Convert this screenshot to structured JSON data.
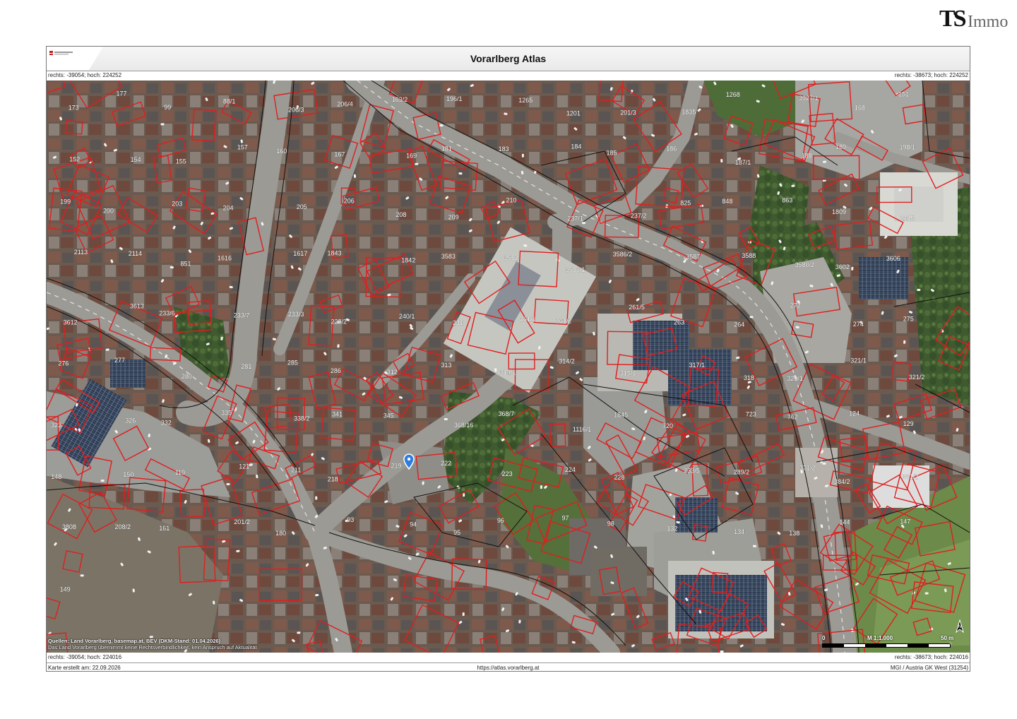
{
  "brand": {
    "ts": "TS",
    "immo": "Immo"
  },
  "header": {
    "title": "Vorarlberg Atlas"
  },
  "coords": {
    "top_left": "rechts: -39054; hoch: 224252",
    "top_right": "rechts: -38673; hoch: 224252",
    "bottom_left": "rechts: -39054; hoch: 224016",
    "bottom_right": "rechts: -38673; hoch: 224016"
  },
  "footer": {
    "created": "Karte erstellt am: 22.09.2026",
    "url": "https://atlas.vorarlberg.at",
    "crs": "MGI / Austria GK West (31254)"
  },
  "map": {
    "sources_line1": "Quellen: Land Vorarlberg, basemap.at, BEV (DKM-Stand: 01.04.2026)",
    "sources_line2": "Das Land Vorarlberg übernimmt keine Rechtsverbindlichkeit, kein Anspruch auf Aktualität",
    "scale_zero": "0",
    "scale_ratio": "M 1:1.000",
    "scale_max": "50 m",
    "north_label": "N",
    "parcels": [
      "173",
      "177",
      "99",
      "88/1",
      "206/3",
      "206/4",
      "163/2",
      "196/1",
      "1265",
      "1201",
      "201/3",
      "1835",
      "1268",
      "3927/1",
      "168",
      "151",
      "152",
      "154",
      "155",
      "157",
      "160",
      "167",
      "169",
      "181",
      "183",
      "184",
      "185",
      "186",
      "187/1",
      "188",
      "189",
      "198/1",
      "199",
      "200",
      "203",
      "204",
      "205",
      "206",
      "208",
      "209",
      "210",
      "237/1",
      "237/2",
      "825",
      "848",
      "863",
      "1809",
      "2115",
      "2113",
      "2114",
      "851",
      "1616",
      "1617",
      "1843",
      "1842",
      "3583",
      "3582",
      "3586/1",
      "3586/2",
      "3587",
      "3588",
      "3580/2",
      "3602",
      "3606",
      "3612",
      "3613",
      "233/6",
      "233/7",
      "233/3",
      "228/2",
      "240/1",
      "241",
      "261/1",
      "261/2",
      "261/5",
      "263",
      "264",
      "272",
      "274",
      "275",
      "276",
      "277",
      "280",
      "281",
      "285",
      "286",
      "312",
      "313",
      "314/1",
      "314/2",
      "315/1",
      "317/1",
      "318",
      "320/1",
      "321/1",
      "321/2",
      "323",
      "326",
      "332",
      "335",
      "338/2",
      "341",
      "345",
      "368/16",
      "368/7",
      "1116/1",
      "1845",
      "720",
      "723",
      "762",
      "124",
      "129",
      "148",
      "150",
      "119",
      "121",
      "211",
      "218",
      "219",
      "222",
      "223",
      "224",
      "228",
      "233/5",
      "289/2",
      "371/2",
      "384/2",
      "381/2",
      "3808",
      "208/2",
      "161",
      "201/2",
      "180",
      "93",
      "94",
      "95",
      "96",
      "97",
      "98",
      "132",
      "134",
      "138",
      "144",
      "147",
      "149"
    ]
  }
}
